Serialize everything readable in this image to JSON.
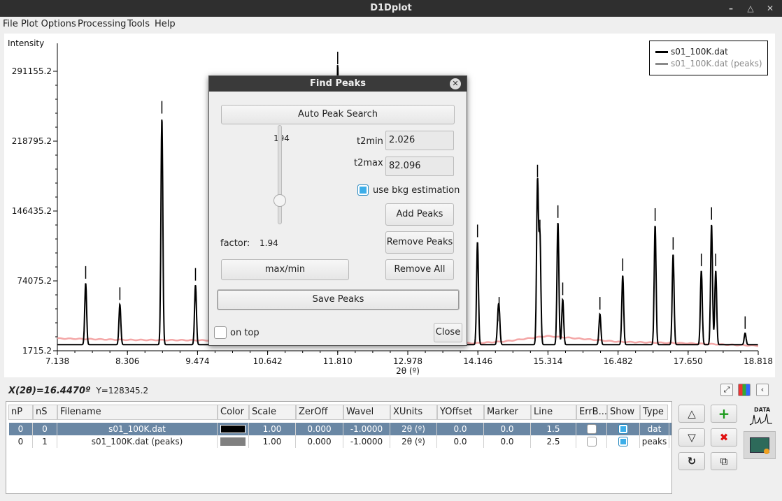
{
  "window": {
    "title": "D1Dplot"
  },
  "menu": [
    "File",
    "Plot Options",
    "Processing",
    "Tools",
    "Help"
  ],
  "plot": {
    "ylabel": "Intensity",
    "xlabel": "2θ (º)",
    "y_ticks": [
      "291155.2",
      "218795.2",
      "146435.2",
      "74075.2",
      "1715.2"
    ],
    "x_ticks": [
      "7.138",
      "8.306",
      "9.474",
      "10.642",
      "11.810",
      "12.978",
      "14.146",
      "15.314",
      "16.482",
      "17.650",
      "18.818"
    ],
    "legend": [
      {
        "label": "s01_100K.dat",
        "color": "#000000"
      },
      {
        "label": "s01_100K.dat (peaks)",
        "color": "#8a8a8a"
      }
    ]
  },
  "chart_data": {
    "type": "line",
    "xlabel": "2θ (º)",
    "ylabel": "Intensity",
    "xlim": [
      7.138,
      18.818
    ],
    "ylim": [
      1715.2,
      291155.2
    ],
    "grid": false,
    "legend_position": "top-right",
    "series": [
      {
        "name": "s01_100K.dat",
        "color": "#000000",
        "baseline": 8000,
        "peaks": [
          {
            "x": 7.61,
            "y": 72000
          },
          {
            "x": 8.18,
            "y": 50000
          },
          {
            "x": 8.88,
            "y": 243000
          },
          {
            "x": 9.44,
            "y": 70000
          },
          {
            "x": 11.81,
            "y": 300000
          },
          {
            "x": 14.14,
            "y": 115000
          },
          {
            "x": 14.48,
            "y": 28000
          },
          {
            "x": 14.5,
            "y": 40000
          },
          {
            "x": 15.14,
            "y": 177000
          },
          {
            "x": 15.18,
            "y": 120000
          },
          {
            "x": 15.48,
            "y": 135000
          },
          {
            "x": 15.56,
            "y": 55000
          },
          {
            "x": 16.18,
            "y": 40000
          },
          {
            "x": 16.56,
            "y": 80000
          },
          {
            "x": 17.1,
            "y": 132000
          },
          {
            "x": 17.4,
            "y": 102000
          },
          {
            "x": 17.87,
            "y": 85000
          },
          {
            "x": 18.04,
            "y": 133000
          },
          {
            "x": 18.11,
            "y": 85000
          },
          {
            "x": 18.6,
            "y": 20000
          }
        ]
      },
      {
        "name": "s01_100K.dat (peaks)",
        "color": "#8a8a8a",
        "markers_x": [
          7.61,
          8.18,
          8.88,
          9.44,
          11.81,
          14.14,
          14.48,
          14.5,
          15.14,
          15.18,
          15.48,
          15.56,
          16.18,
          16.56,
          17.1,
          17.4,
          17.87,
          18.04,
          18.11,
          18.6
        ]
      },
      {
        "name": "background",
        "color": "#f4a7a7",
        "x": [
          7.138,
          8.3,
          9.5,
          10.6,
          11.8,
          13.0,
          14.1,
          14.6,
          15.3,
          16.5,
          17.6,
          18.818
        ],
        "y": [
          14500,
          13000,
          12600,
          12000,
          11500,
          11000,
          9500,
          11500,
          17000,
          11000,
          9500,
          7000
        ]
      }
    ]
  },
  "dialog": {
    "title": "Find Peaks",
    "auto_peak_search": "Auto Peak Search",
    "slider_value": "194",
    "t2min_label": "t2min",
    "t2min_value": "2.026",
    "t2max_label": "t2max",
    "t2max_value": "82.096",
    "bkg_label": "use bkg estimation",
    "bkg_checked": true,
    "add_peaks": "Add Peaks",
    "remove_peaks": "Remove Peaks",
    "remove_all": "Remove All",
    "factor_label": "factor:",
    "factor_value": "1.94",
    "maxmin": "max/min",
    "save_peaks": "Save Peaks",
    "on_top": "on top",
    "close": "Close"
  },
  "status": {
    "x_readout": "X(2θ)=16.4470º",
    "y_readout": "Y=128345.2"
  },
  "table": {
    "headers": [
      "nP",
      "nS",
      "Filename",
      "Color",
      "Scale",
      "ZerOff",
      "Wavel",
      "XUnits",
      "YOffset",
      "Marker",
      "Line",
      "ErrB...",
      "Show",
      "Type"
    ],
    "rows": [
      {
        "nP": "0",
        "nS": "0",
        "filename": "s01_100K.dat",
        "color": "#000000",
        "scale": "1.00",
        "zeroff": "0.000",
        "wavel": "-1.0000",
        "xunits": "2θ (º)",
        "yoffset": "0.0",
        "marker": "0.0",
        "line": "1.5",
        "errb": false,
        "show": true,
        "type": "dat",
        "selected": true
      },
      {
        "nP": "0",
        "nS": "1",
        "filename": "s01_100K.dat (peaks)",
        "color": "#808080",
        "scale": "1.00",
        "zeroff": "0.000",
        "wavel": "-1.0000",
        "xunits": "2θ (º)",
        "yoffset": "0.0",
        "marker": "0.0",
        "line": "2.5",
        "errb": false,
        "show": true,
        "type": "peaks",
        "selected": false
      }
    ]
  },
  "side": {
    "data_label": "DATA"
  },
  "colors": {
    "selection": "#6a87a4",
    "accent": "#3daee9",
    "add": "#1a9a1a",
    "remove": "#e01010",
    "bkg": "#f4a7a7"
  }
}
